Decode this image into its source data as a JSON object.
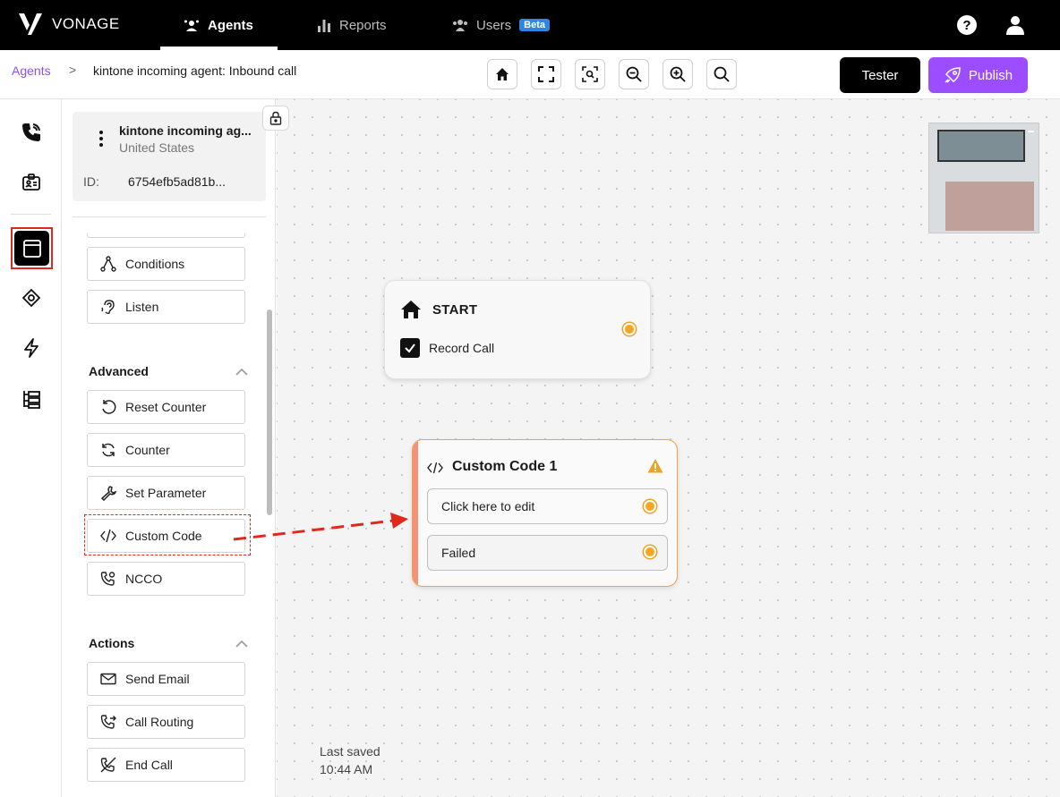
{
  "brand": {
    "name": "VONAGE"
  },
  "nav": {
    "agents": "Agents",
    "reports": "Reports",
    "users": "Users",
    "users_badge": "Beta"
  },
  "breadcrumb": {
    "root": "Agents",
    "separator": ">",
    "current": "kintone incoming agent: Inbound call"
  },
  "toolbar": {
    "tester_label": "Tester",
    "publish_label": "Publish",
    "icons": [
      "home-icon",
      "fit-screen-icon",
      "focus-icon",
      "zoom-out-icon",
      "zoom-in-icon",
      "search-icon"
    ]
  },
  "agent": {
    "name": "kintone incoming ag...",
    "country": "United States",
    "id_label": "ID:",
    "id_value": "6754efb5ad81b..."
  },
  "panel": {
    "nodes_top": [
      {
        "label": "Conditions",
        "icon": "conditions-icon"
      },
      {
        "label": "Listen",
        "icon": "ear-icon"
      }
    ],
    "advanced": {
      "title": "Advanced",
      "items": [
        {
          "label": "Reset Counter",
          "icon": "reset-icon"
        },
        {
          "label": "Counter",
          "icon": "refresh-icon"
        },
        {
          "label": "Set Parameter",
          "icon": "wrench-icon"
        },
        {
          "label": "Custom Code",
          "icon": "code-icon"
        },
        {
          "label": "NCCO",
          "icon": "phone-settings-icon"
        }
      ]
    },
    "actions": {
      "title": "Actions",
      "items": [
        {
          "label": "Send Email",
          "icon": "mail-icon"
        },
        {
          "label": "Call Routing",
          "icon": "call-forward-icon"
        },
        {
          "label": "End Call",
          "icon": "end-call-icon"
        }
      ]
    }
  },
  "canvas": {
    "start_node": {
      "title": "START",
      "checkbox_label": "Record Call",
      "checked": true
    },
    "code_node": {
      "title": "Custom Code 1",
      "fields": [
        "Click here to edit",
        "Failed"
      ]
    },
    "last_saved_label": "Last saved",
    "last_saved_time": "10:44 AM"
  },
  "colors": {
    "accent_purple": "#9b4dff",
    "port_orange": "#f6a622",
    "annotation_red": "#e0281c",
    "beta_blue": "#2f86e0"
  }
}
